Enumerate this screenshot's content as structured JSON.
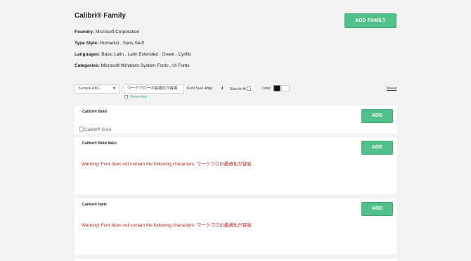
{
  "family": {
    "title": "Calibri® Family",
    "foundry_label": "Foundry:",
    "foundry_value": "Microsoft Corporation",
    "type_style_label": "Type Style:",
    "type_style_value": "Humanist , Sans Serif",
    "languages_label": "Languages:",
    "languages_value": "Basic Latin , Latin Extended , Greek , Cyrillic",
    "categories_label": "Categories:",
    "categories_value": "Microsoft Windows System Fonts , UI Fonts",
    "add_family_label": "ADD FAMILY"
  },
  "toolbar": {
    "sample_select": "Sample ABC",
    "sample_text": "ワークフローの最適化が容易",
    "remember_label": "Remember",
    "font_size_label": "Font Size 48px",
    "size_to_fit_label": "Size to fit",
    "color_label": "Color",
    "reset_label": "Reset",
    "colors": {
      "foreground": "#111111",
      "background": "#ffffff"
    }
  },
  "cards": [
    {
      "title": "Calibri® Bold",
      "add_label": "ADD",
      "preview_alt": "Calibri® Bold",
      "warning": ""
    },
    {
      "title": "Calibri® Bold Italic",
      "add_label": "ADD",
      "preview_alt": "",
      "warning": "Warning! Font does not contain the following characters: ワークフロの最適化が容易"
    },
    {
      "title": "Calibri® Italic",
      "add_label": "ADD",
      "preview_alt": "",
      "warning": "Warning! Font does not contain the following characters: ワークフロの最適化が容易"
    }
  ],
  "accent_color": "#52c08a",
  "warning_color": "#b71c1c"
}
